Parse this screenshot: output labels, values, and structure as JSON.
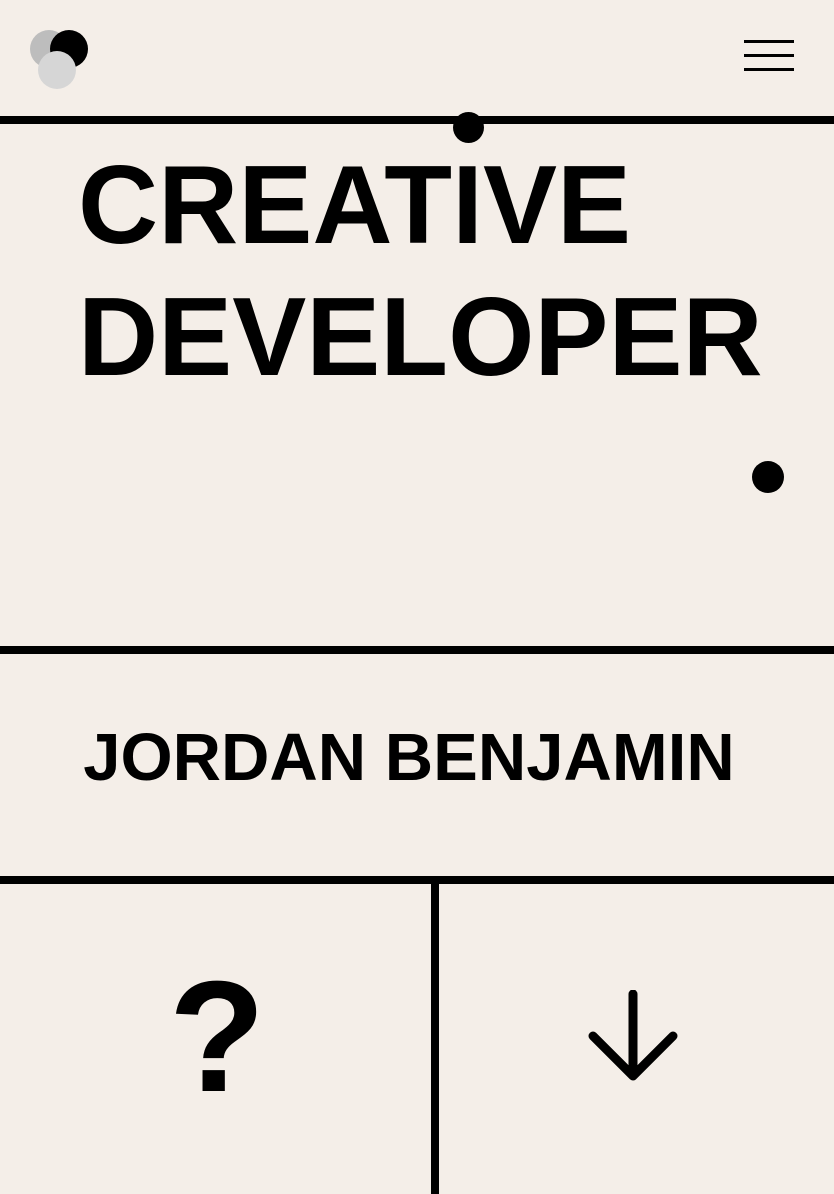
{
  "header": {
    "logo_icon": "overlapping-circles-logo",
    "menu_icon": "hamburger-menu-icon"
  },
  "hero": {
    "line1_part1": "CREAT",
    "line1_i": "I",
    "line1_part2": "VE",
    "line2": "DEVELOPER"
  },
  "name": "JORDAN BENJAMIN",
  "actions": {
    "about_symbol": "?",
    "scroll_icon": "arrow-down-icon"
  },
  "colors": {
    "background": "#f4eee8",
    "foreground": "#000000",
    "logo_light": "#d6d6d6",
    "logo_mid": "#bdbdbd"
  }
}
